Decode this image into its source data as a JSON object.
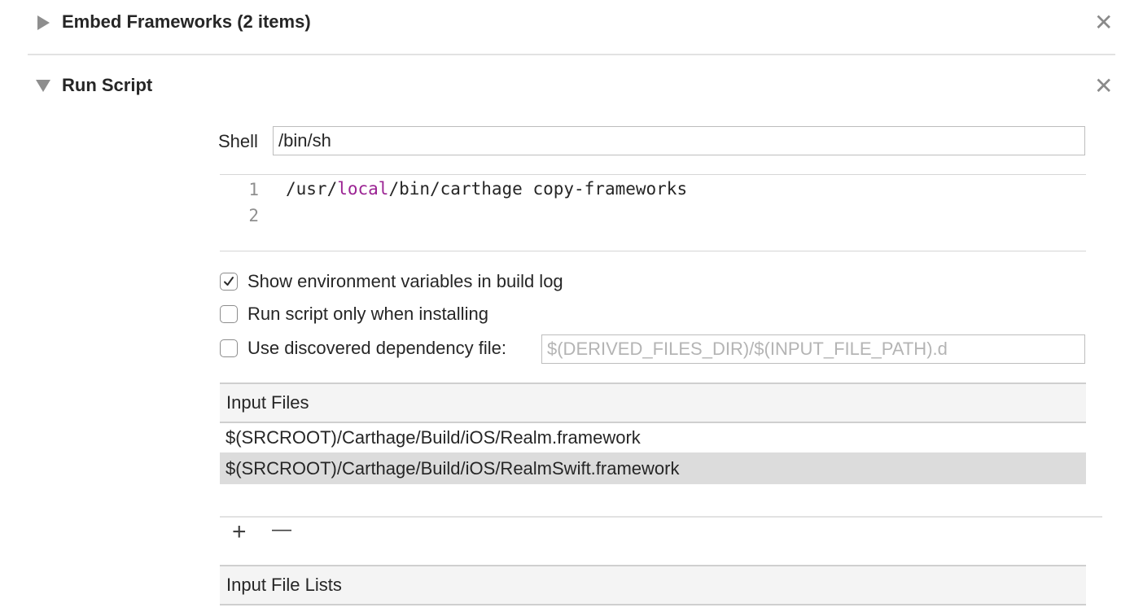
{
  "phases": {
    "embed": {
      "title": "Embed Frameworks (2 items)",
      "close_icon": "✕",
      "disclosure_icon": "triangle-right-icon"
    },
    "run_script": {
      "title": "Run Script",
      "close_icon": "✕",
      "disclosure_icon": "triangle-down-icon"
    }
  },
  "run_script": {
    "shell_label": "Shell",
    "shell_value": "/bin/sh",
    "script": {
      "line_numbers": [
        "1",
        "2"
      ],
      "line1_prefix": "/usr/",
      "line1_keyword": "local",
      "line1_suffix": "/bin/carthage copy-frameworks"
    },
    "options": [
      {
        "label": "Show environment variables in build log",
        "checked": true
      },
      {
        "label": "Run script only when installing",
        "checked": false
      },
      {
        "label": "Use discovered dependency file:",
        "checked": false
      }
    ],
    "dependency_file_placeholder": "$(DERIVED_FILES_DIR)/$(INPUT_FILE_PATH).d",
    "input_files": {
      "header": "Input Files",
      "rows": [
        "$(SRCROOT)/Carthage/Build/iOS/Realm.framework",
        "$(SRCROOT)/Carthage/Build/iOS/RealmSwift.framework"
      ],
      "selected_index": 1,
      "add_label": "+",
      "remove_label": "—"
    },
    "input_file_lists": {
      "header": "Input File Lists"
    }
  },
  "colors": {
    "keyword": "#9b2393",
    "selected_row": "#dcdcdc",
    "header_bg": "#f4f4f4"
  }
}
